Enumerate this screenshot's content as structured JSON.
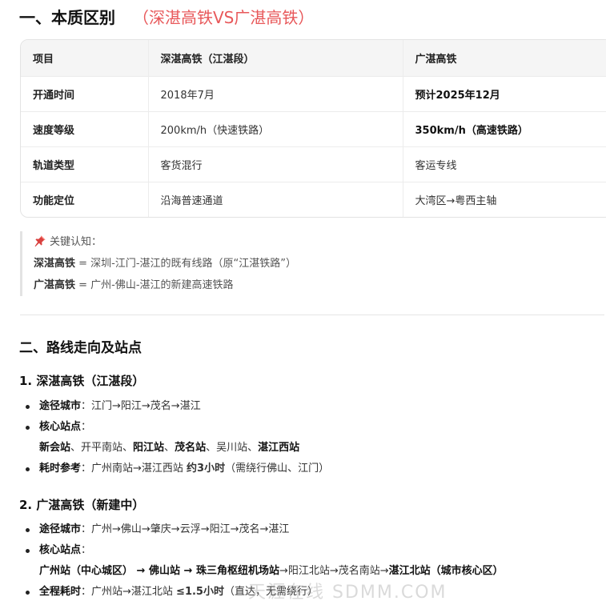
{
  "section1": {
    "title": "一、本质区别",
    "title_accent": "（深湛高铁VS广湛高铁）"
  },
  "table": {
    "headers": [
      "项目",
      "深湛高铁（江湛段）",
      "广湛高铁"
    ],
    "rows": [
      [
        "开通时间",
        "2018年7月",
        "预计2025年12月"
      ],
      [
        "速度等级",
        "200km/h（快速铁路）",
        "350km/h（高速铁路）"
      ],
      [
        "轨道类型",
        "客货混行",
        "客运专线"
      ],
      [
        "功能定位",
        "沿海普速通道",
        "大湾区→粤西主轴"
      ]
    ]
  },
  "note": {
    "icon": "pushpin-icon",
    "title": "关键认知：",
    "line1_bold": "深湛高铁",
    "line1_text": " = 深圳-江门-湛江的既有线路（原“江湛铁路”）",
    "line2_bold": "广湛高铁",
    "line2_text": " = 广州-佛山-湛江的新建高速铁路"
  },
  "section2": {
    "title": "二、路线走向及站点",
    "sub1": {
      "title": "1. 深湛高铁（江湛段）",
      "cities_label": "途径城市",
      "cities": "：江门→阳江→茂名→湛江",
      "stations_label": "核心站点",
      "stations_colon": "：",
      "stations": [
        {
          "t": "新会站",
          "b": true
        },
        {
          "t": "、开平南站、",
          "b": false
        },
        {
          "t": "阳江站",
          "b": true
        },
        {
          "t": "、",
          "b": false
        },
        {
          "t": "茂名站",
          "b": true
        },
        {
          "t": "、吴川站、",
          "b": false
        },
        {
          "t": "湛江西站",
          "b": true
        }
      ],
      "time_label": "耗时参考",
      "time_text": "：广州南站→湛江西站 ",
      "time_bold": "约3小时",
      "time_tail": "（需绕行佛山、江门）"
    },
    "sub2": {
      "title": "2. 广湛高铁（新建中）",
      "cities_label": "途径城市",
      "cities": "：广州→佛山→肇庆→云浮→阳江→茂名→湛江",
      "stations_label": "核心站点",
      "stations_colon": "：",
      "stations": [
        {
          "t": "广州站（中心城区）",
          "b": true
        },
        {
          "t": " → ",
          "b": true
        },
        {
          "t": "佛山站",
          "b": true
        },
        {
          "t": " → ",
          "b": true
        },
        {
          "t": "珠三角枢纽机场站",
          "b": true
        },
        {
          "t": "→阳江北站→茂名南站→",
          "b": false
        },
        {
          "t": "湛江北站（城市核心区）",
          "b": true
        }
      ],
      "time_label": "全程耗时",
      "time_text": "：广州站→湛江北站 ",
      "time_bold": "≤1.5小时",
      "time_tail": "（直达，无需绕行）"
    }
  },
  "watermark": "天涯在线 SDMM.COM"
}
